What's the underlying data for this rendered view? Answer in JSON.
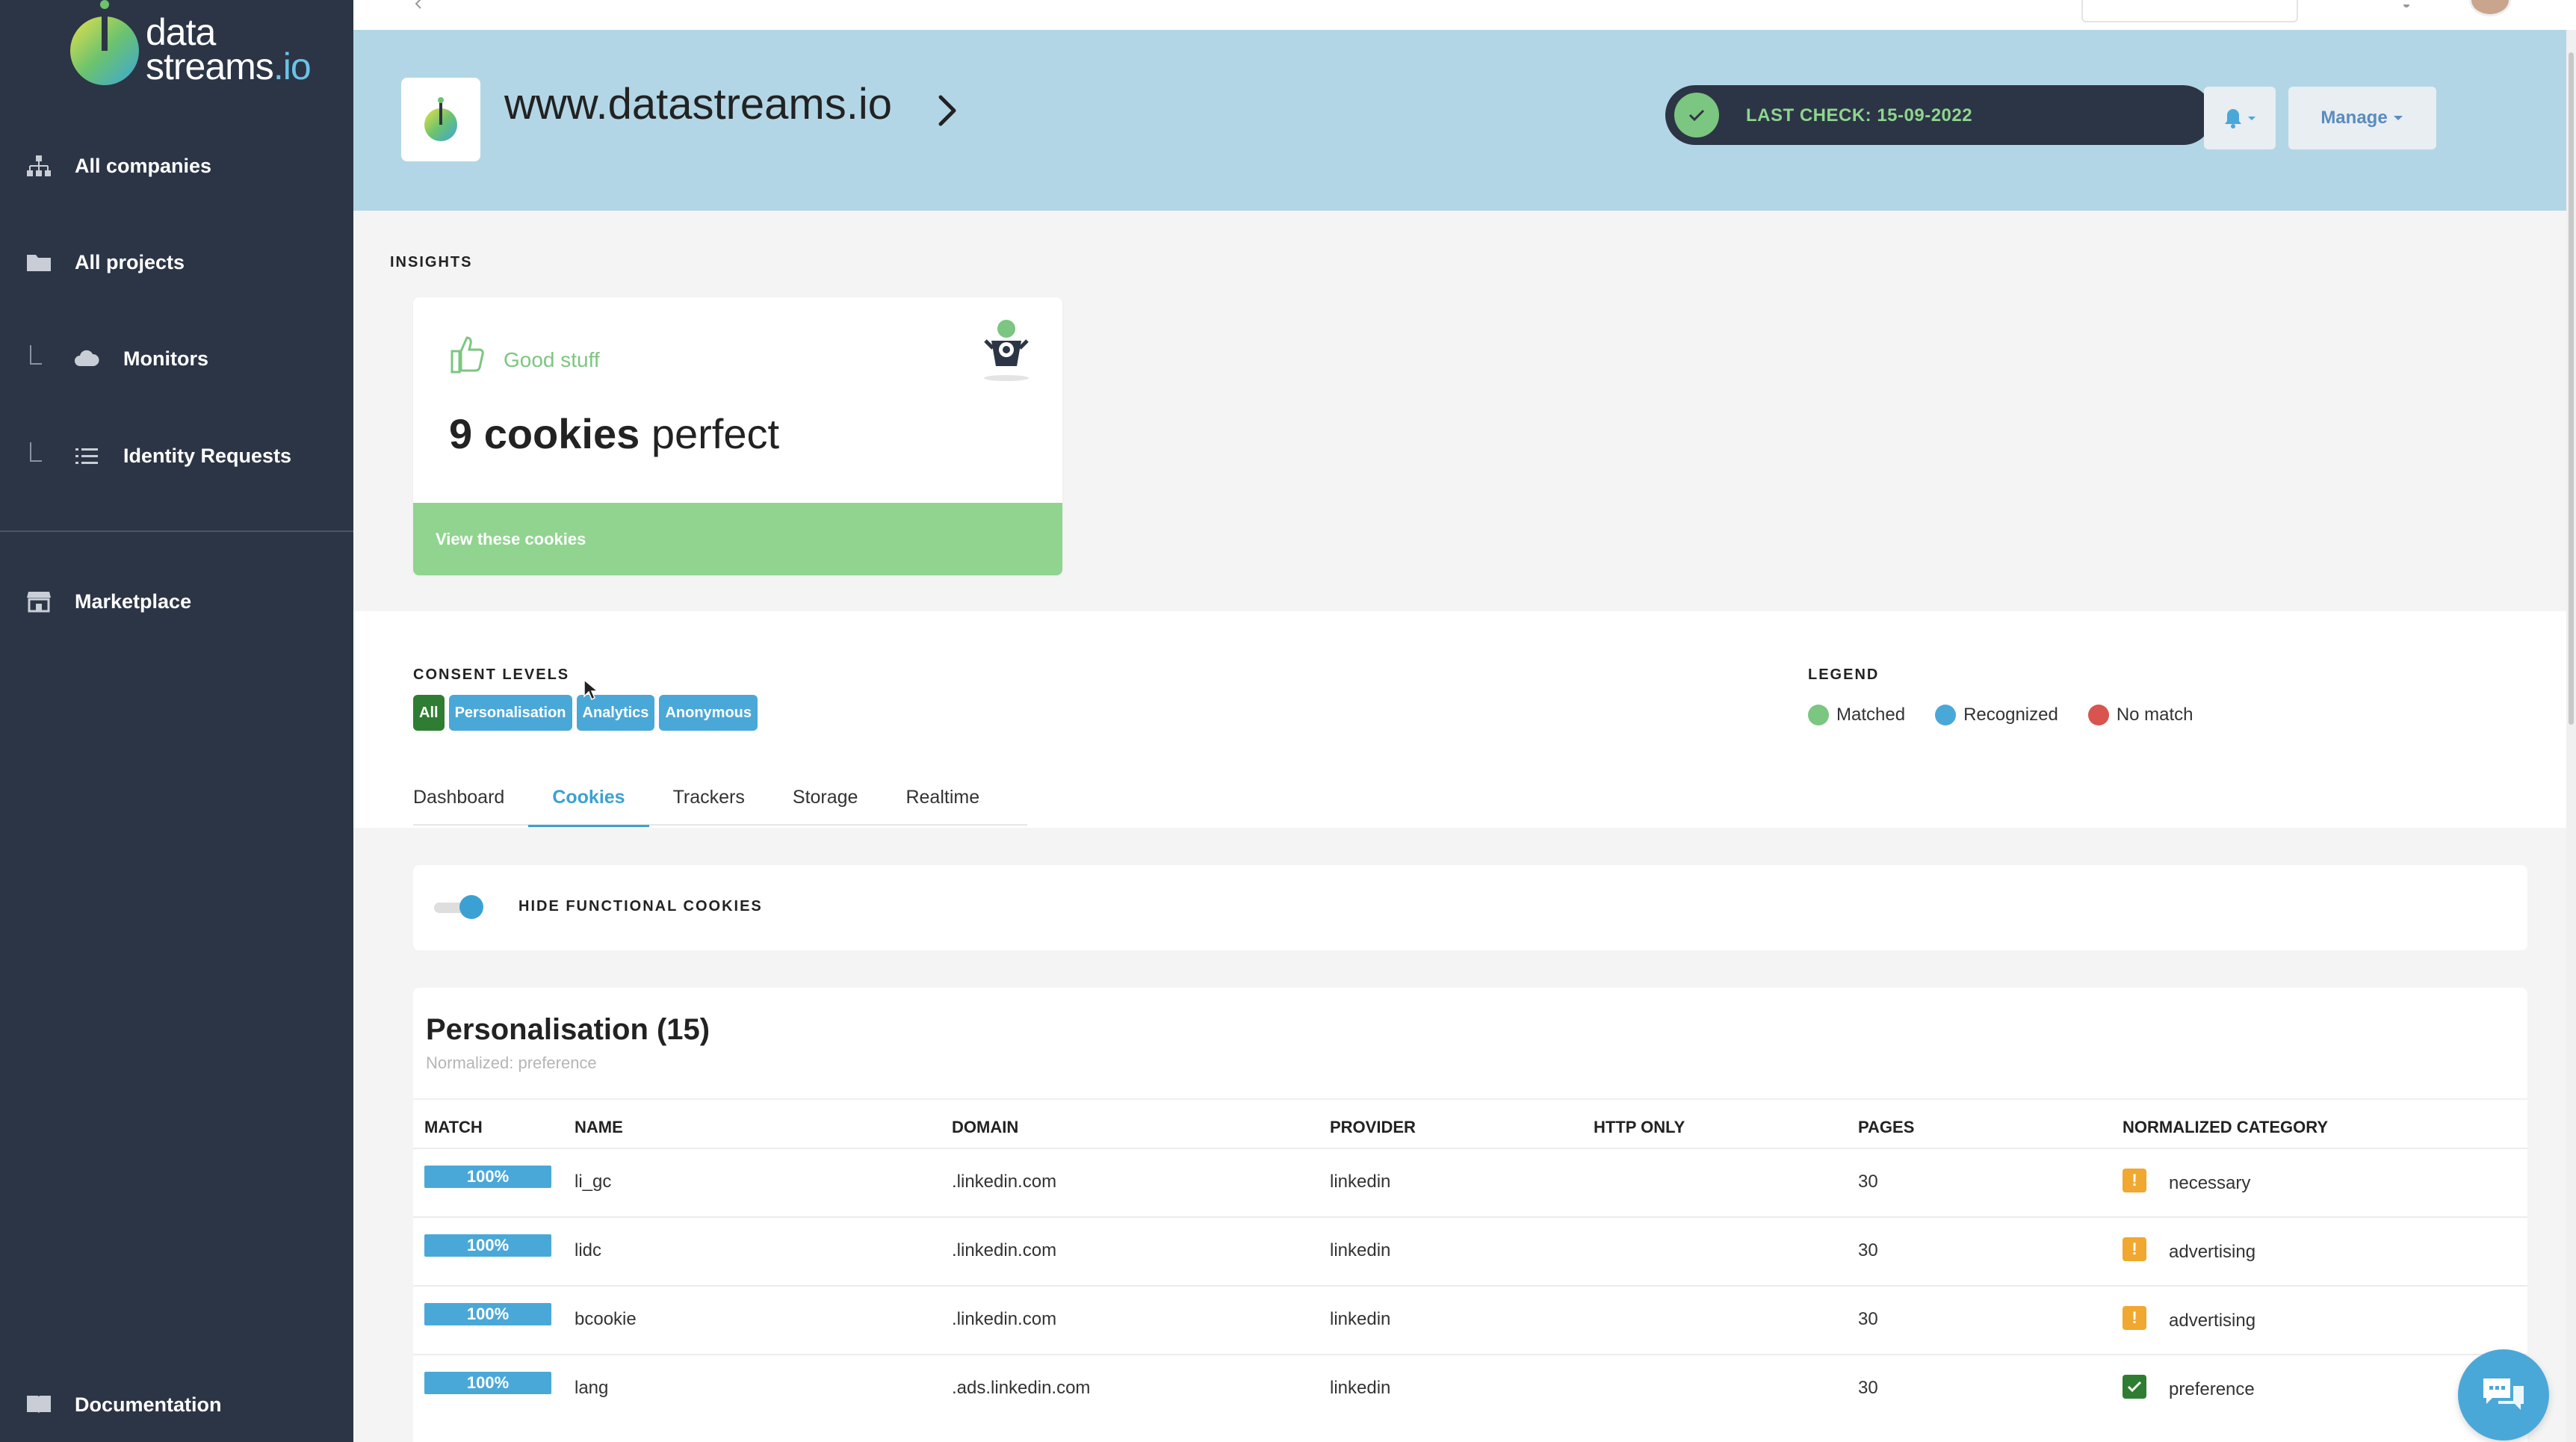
{
  "brand": {
    "logo_line1": "data",
    "logo_line2": "streams",
    "logo_suffix": ".io"
  },
  "sidebar": {
    "items": [
      {
        "label": "All companies",
        "icon": "sitemap-icon"
      },
      {
        "label": "All projects",
        "icon": "folder-icon"
      },
      {
        "label": "Monitors",
        "icon": "cloud-icon"
      },
      {
        "label": "Identity Requests",
        "icon": "list-icon"
      },
      {
        "label": "Marketplace",
        "icon": "store-icon"
      },
      {
        "label": "Documentation",
        "icon": "book-icon"
      }
    ]
  },
  "header": {
    "site_title": "www.datastreams.io",
    "last_check": "LAST CHECK: 15-09-2022",
    "manage_label": "Manage"
  },
  "insights": {
    "section_label": "INSIGHTS",
    "card": {
      "status": "Good stuff",
      "count_bold": "9 cookies",
      "count_rest": " perfect",
      "action": "View these cookies"
    }
  },
  "consent": {
    "section_label": "CONSENT LEVELS",
    "chips": [
      {
        "label": "All",
        "color": "#2e7d32"
      },
      {
        "label": "Personalisation",
        "color": "#4aa8d8"
      },
      {
        "label": "Analytics",
        "color": "#4aa8d8"
      },
      {
        "label": "Anonymous",
        "color": "#4aa8d8"
      }
    ]
  },
  "legend": {
    "section_label": "LEGEND",
    "items": [
      {
        "label": "Matched",
        "color": "#7bc680"
      },
      {
        "label": "Recognized",
        "color": "#4aa8d8"
      },
      {
        "label": "No match",
        "color": "#d9534f"
      }
    ]
  },
  "tabs": [
    {
      "label": "Dashboard",
      "active": false
    },
    {
      "label": "Cookies",
      "active": true
    },
    {
      "label": "Trackers",
      "active": false
    },
    {
      "label": "Storage",
      "active": false
    },
    {
      "label": "Realtime",
      "active": false
    }
  ],
  "toggle": {
    "label": "HIDE FUNCTIONAL COOKIES",
    "on": true
  },
  "table": {
    "title": "Personalisation (15)",
    "subtitle": "Normalized: preference",
    "columns": [
      "MATCH",
      "NAME",
      "DOMAIN",
      "PROVIDER",
      "HTTP ONLY",
      "PAGES",
      "NORMALIZED CATEGORY"
    ],
    "rows": [
      {
        "match": "100%",
        "name": "li_gc",
        "domain": ".linkedin.com",
        "provider": "linkedin",
        "http_only": "",
        "pages": "30",
        "category": "necessary",
        "cat_status": "warning"
      },
      {
        "match": "100%",
        "name": "lidc",
        "domain": ".linkedin.com",
        "provider": "linkedin",
        "http_only": "",
        "pages": "30",
        "category": "advertising",
        "cat_status": "warning"
      },
      {
        "match": "100%",
        "name": "bcookie",
        "domain": ".linkedin.com",
        "provider": "linkedin",
        "http_only": "",
        "pages": "30",
        "category": "advertising",
        "cat_status": "warning"
      },
      {
        "match": "100%",
        "name": "lang",
        "domain": ".ads.linkedin.com",
        "provider": "linkedin",
        "http_only": "",
        "pages": "30",
        "category": "preference",
        "cat_status": "ok"
      }
    ]
  },
  "colors": {
    "sidebar_bg": "#2c3545",
    "banner_bg": "#b3d6e6",
    "accent_blue": "#4aa8d8",
    "accent_green": "#7bc680",
    "warning": "#f0a830",
    "ok": "#2e7d32"
  }
}
